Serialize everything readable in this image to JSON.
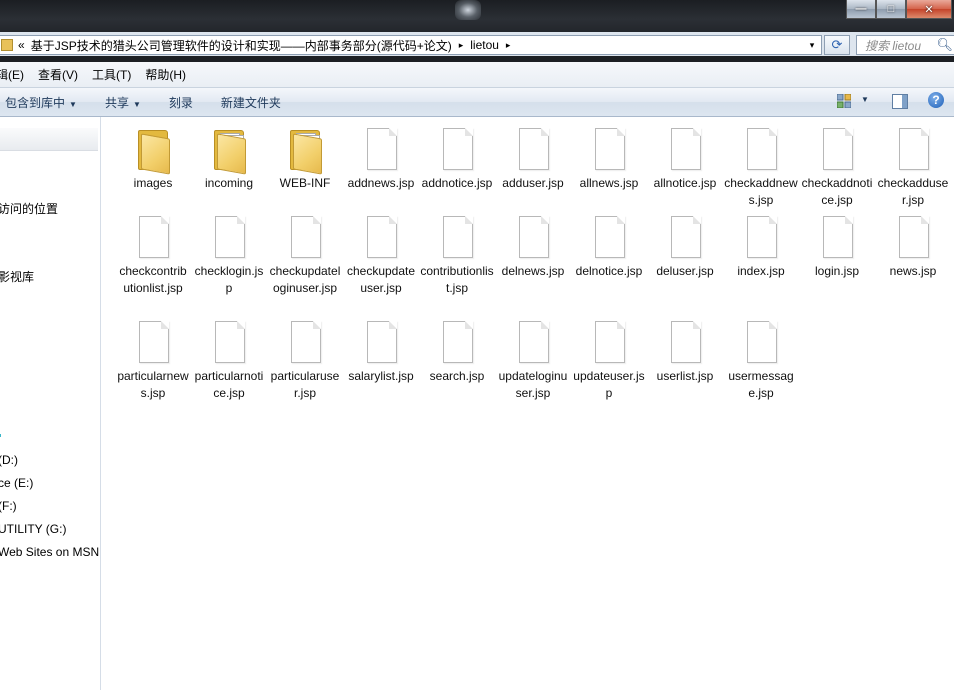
{
  "window": {
    "buttons": {
      "minimize": "—",
      "maximize": "□",
      "close": "✕"
    }
  },
  "address": {
    "segments": [
      "«",
      "基于JSP技术的猎头公司管理软件的设计和实现——内部事务部分(源代码+论文)",
      "lietou"
    ],
    "separator": "▸",
    "dropdown": "▾",
    "refresh": "⟳"
  },
  "search": {
    "placeholder": "搜索 lietou",
    "icon": "search-icon"
  },
  "menu": {
    "items": [
      {
        "label": "辑(E)"
      },
      {
        "label": "查看(V)"
      },
      {
        "label": "工具(T)"
      },
      {
        "label": "帮助(H)"
      }
    ]
  },
  "toolbar": {
    "include_library": "包含到库中",
    "share": "共享",
    "burn": "刻录",
    "new_folder": "新建文件夹",
    "dropdown_arrow": "▼",
    "help": "?"
  },
  "nav": {
    "items": [
      "访问的位置",
      "影视库",
      "(D:)",
      "ce (E:)",
      " (F:)",
      "UTILITY (G:)",
      "Web Sites on MSN"
    ]
  },
  "files": [
    {
      "name": "images",
      "type": "folder"
    },
    {
      "name": "incoming",
      "type": "folder"
    },
    {
      "name": "WEB-INF",
      "type": "folder"
    },
    {
      "name": "addnews.jsp",
      "type": "file"
    },
    {
      "name": "addnotice.jsp",
      "type": "file"
    },
    {
      "name": "adduser.jsp",
      "type": "file"
    },
    {
      "name": "allnews.jsp",
      "type": "file"
    },
    {
      "name": "allnotice.jsp",
      "type": "file"
    },
    {
      "name": "checkaddnews.jsp",
      "type": "file"
    },
    {
      "name": "checkaddnotice.jsp",
      "type": "file"
    },
    {
      "name": "checkadduser.jsp",
      "type": "file"
    },
    {
      "name": "checkcontributionlist.jsp",
      "type": "file"
    },
    {
      "name": "checklogin.jsp",
      "type": "file"
    },
    {
      "name": "checkupdateloginuser.jsp",
      "type": "file"
    },
    {
      "name": "checkupdateuser.jsp",
      "type": "file"
    },
    {
      "name": "contributionlist.jsp",
      "type": "file"
    },
    {
      "name": "delnews.jsp",
      "type": "file"
    },
    {
      "name": "delnotice.jsp",
      "type": "file"
    },
    {
      "name": "deluser.jsp",
      "type": "file"
    },
    {
      "name": "index.jsp",
      "type": "file"
    },
    {
      "name": "login.jsp",
      "type": "file"
    },
    {
      "name": "news.jsp",
      "type": "file"
    },
    {
      "name": "particularnews.jsp",
      "type": "file"
    },
    {
      "name": "particularnotice.jsp",
      "type": "file"
    },
    {
      "name": "particularuser.jsp",
      "type": "file"
    },
    {
      "name": "salarylist.jsp",
      "type": "file"
    },
    {
      "name": "search.jsp",
      "type": "file"
    },
    {
      "name": "updateloginuser.jsp",
      "type": "file"
    },
    {
      "name": "updateuser.jsp",
      "type": "file"
    },
    {
      "name": "userlist.jsp",
      "type": "file"
    },
    {
      "name": "usermessage.jsp",
      "type": "file"
    }
  ]
}
